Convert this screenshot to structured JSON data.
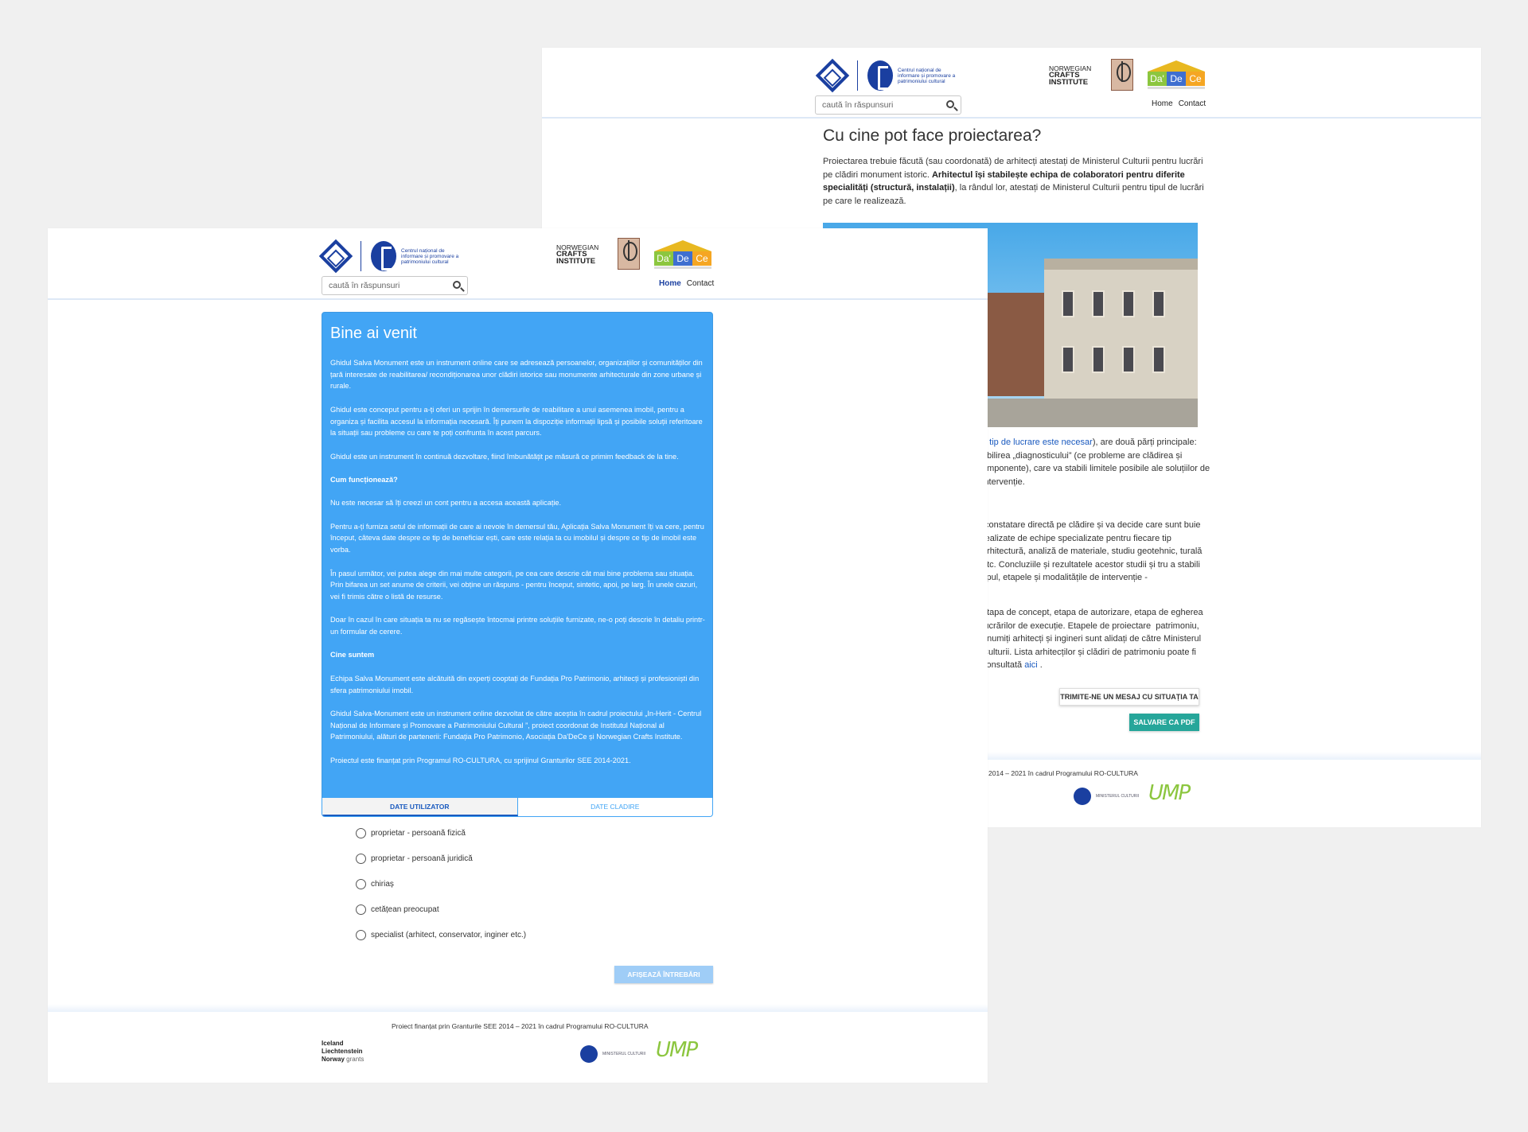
{
  "header": {
    "search_placeholder": "caută în răspunsuri",
    "cn_logo_text": "Centrul național de informare și promovare a patrimoniului cultural",
    "ncl": {
      "line1": "NORWEGIAN",
      "line2": "CRAFTS",
      "line3": "INSTITUTE"
    },
    "dadece": [
      "Da'",
      "De",
      "Ce"
    ],
    "nav": {
      "home": "Home",
      "contact": "Contact"
    }
  },
  "back_page": {
    "title": "Cu cine pot face proiectarea?",
    "para_normal1": "Proiectarea trebuie făcută (sau coordonată) de arhitecți atestați de Ministerul Culturii pentru lucrări pe clădiri monument istoric. ",
    "para_bold": "Arhitectul își stabilește echipa de colaboratori pentru diferite specialități (structură, instalații)",
    "para_normal2": ", la rândul lor, atestați de Ministerul Culturii pentru tipul de lucrări pe care le realizează.",
    "text_a_link": "e tip de lucrare este necesar",
    "text_a_rest": "), are două părți principale: ⁠abilirea „diagnosticului” (ce probleme are clădirea și ⁠omponente), care va stabili limitele posibile ale soluțiilor de intervenție.",
    "text_b": "⁠ constatare directă pe clădire și va decide care sunt ⁠buie realizate de echipe specializate pentru fiecare tip ⁠ arhitectură, analiză de materiale, studiu geotehnic, ⁠turală etc. Concluziile și rezultatele acestor studii și ⁠tru a stabili tipul, etapele și modalitățile de intervenție -",
    "text_c": "⁠etapa de concept, etapa de autorizare, etapa de ⁠egherea lucrărilor de execuție. Etapele de proiectare ⁠ patrimoniu, anumiți arhitecți și ingineri sunt ⁠alidați de către Ministerul Culturii. Lista arhitecților și ⁠clădiri de patrimoniu poate fi consultată ",
    "text_c_link": "aici",
    "text_c_end": " .",
    "btn_message": "TRIMITE-NE UN MESAJ CU SITUAȚIA TA",
    "btn_pdf": "SALVARE CA PDF",
    "footer_text": "E 2014 – 2021 în cadrul Programului RO-CULTURA",
    "ministry": "MINISTERUL CULTURII",
    "ump": "UMP"
  },
  "front_page": {
    "card_title": "Bine ai venit",
    "paragraphs": [
      "Ghidul Salva Monument este un instrument online care se adresează persoanelor, organizațiilor și comunităților din țară interesate de reabilitarea/ recondiționarea unor clădiri istorice sau monumente arhitecturale din zone urbane și rurale.",
      "Ghidul este conceput pentru a-ți oferi un sprijin în demersurile de reabilitare a unui asemenea imobil, pentru a organiza și facilita accesul la informația necesară. Îți punem la dispoziție informații lipsă și posibile soluții referitoare la situații sau probleme cu care te poți confrunta în acest parcurs.",
      "Ghidul este un instrument în continuă dezvoltare, fiind îmbunătățit pe măsură ce primim feedback de la tine.",
      "Cum funcționează?",
      "Nu este necesar să îți creezi un cont pentru a accesa această aplicație.",
      "Pentru a-ți furniza setul de informații de care ai nevoie în demersul tău, Aplicația Salva Monument îți va cere, pentru început, câteva date despre ce tip de beneficiar ești, care este relația ta cu imobilul și despre ce tip de imobil este vorba.",
      "În pasul următor, vei putea alege din mai multe categorii, pe cea care descrie cât mai bine problema sau situația. Prin bifarea un set anume de criterii, vei obține un răspuns - pentru început, sintetic, apoi, pe larg. În unele cazuri, vei fi trimis către o listă de resurse.",
      "Doar în cazul în care situația ta nu se regăsește întocmai printre soluțiile furnizate, ne-o poți descrie în detaliu printr-un formular de cerere.",
      "Cine suntem",
      "Echipa Salva Monument este alcătuită din experți cooptați de Fundația Pro Patrimonio, arhitecți și profesioniști din sfera patrimoniului imobil.",
      "Ghidul Salva-Monument este un instrument online dezvoltat de către aceștia în cadrul proiectului „In-Herit - Centrul Național de Informare și Promovare a Patrimoniului Cultural ”, proiect coordonat de Institutul Național al Patrimoniului, alături de partenerii: Fundația Pro Patrimonio, Asociația Da'DeCe și Norwegian Crafts Institute.",
      "Proiectul este finanțat prin Programul RO-CULTURA, cu sprijinul Granturilor SEE 2014-2021."
    ],
    "tabs": [
      "DATE UTILIZATOR",
      "DATE CLADIRE"
    ],
    "options": [
      "proprietar - persoană fizică",
      "proprietar - persoană juridică",
      "chiriaș",
      "cetățean preocupat",
      "specialist (arhitect, conservator, inginer etc.)"
    ],
    "show_questions": "AFIȘEAZĂ ÎNTREBĂRI",
    "footer_text": "Proiect finanțat prin Granturile SEE 2014 – 2021 în cadrul Programului RO-CULTURA",
    "eea": {
      "line1": "Iceland",
      "line2": "Liechtenstein",
      "line3": "Norway",
      "grants": "grants"
    },
    "ministry": "MINISTERUL CULTURII",
    "ump": "UMP"
  },
  "colors": {
    "brand_blue": "#1a3fa0",
    "card_blue": "#42a5f5",
    "teal": "#26a69a",
    "link": "#1a5abf"
  }
}
